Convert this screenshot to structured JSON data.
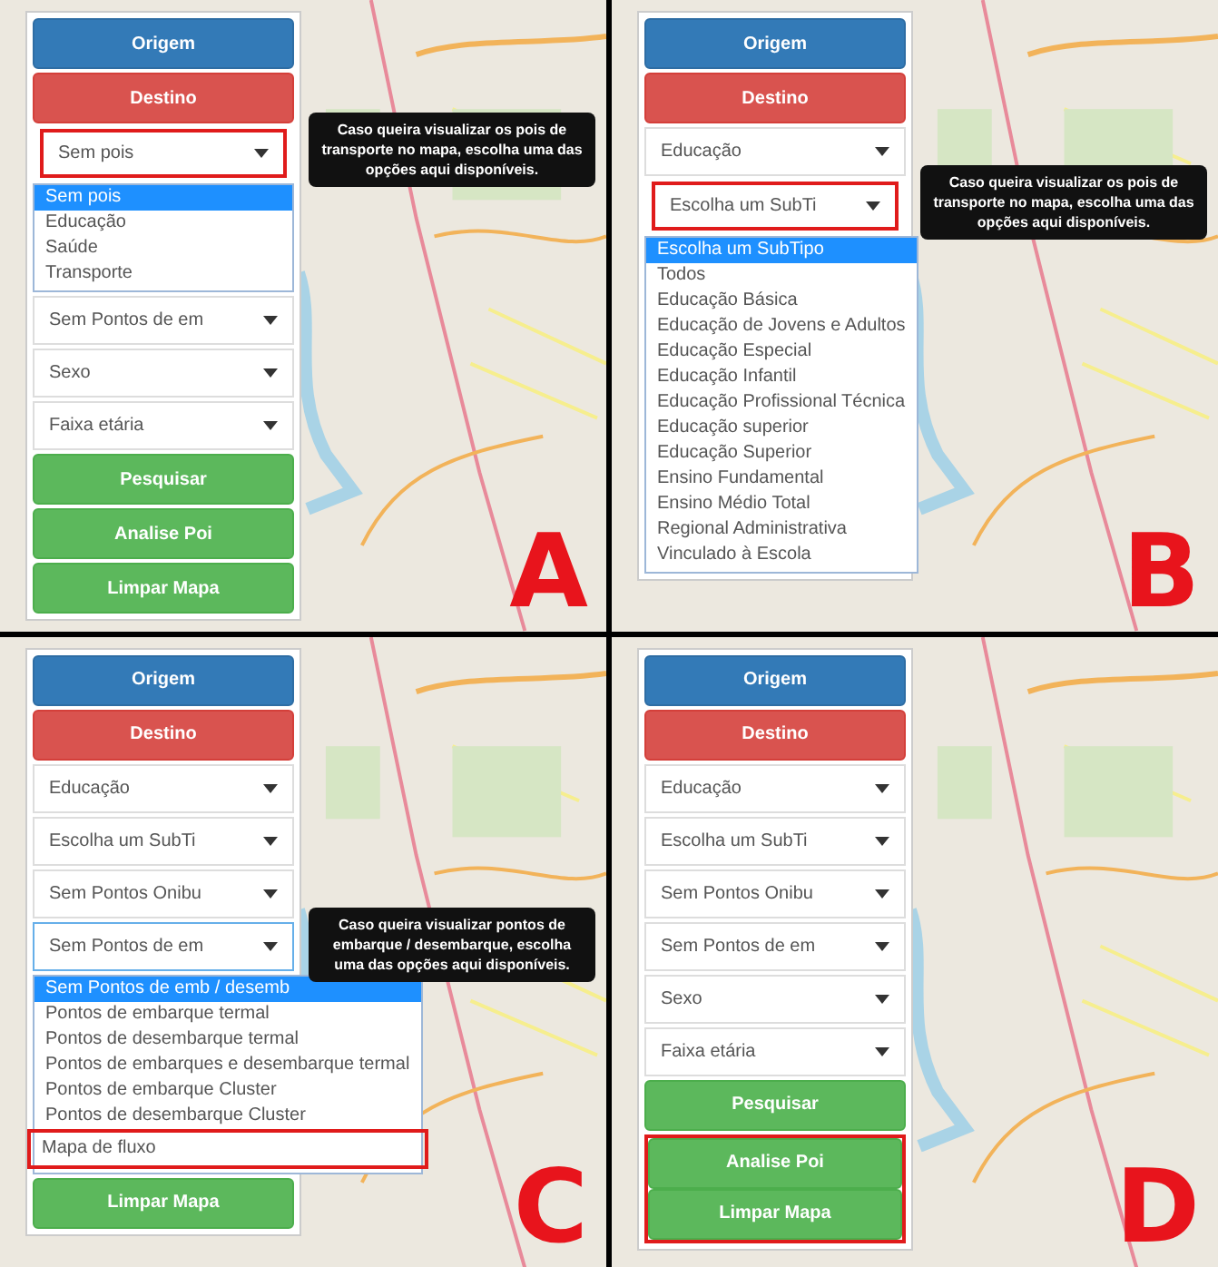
{
  "panels": [
    {
      "letter": "A",
      "controls": [
        {
          "kind": "primary",
          "label": "Origem",
          "highlighted": false
        },
        {
          "kind": "danger",
          "label": "Destino",
          "highlighted": false
        },
        {
          "kind": "select",
          "value": "Sem pois",
          "highlighted": true,
          "open": true,
          "tooltip": "Caso queira visualizar os pois de transporte no mapa, escolha uma das opções aqui disponíveis.",
          "options": [
            {
              "label": "Sem pois",
              "selected": true,
              "highlighted": false
            },
            {
              "label": "Educação",
              "selected": false,
              "highlighted": false
            },
            {
              "label": "Saúde",
              "selected": false,
              "highlighted": false
            },
            {
              "label": "Transporte",
              "selected": false,
              "highlighted": false
            }
          ]
        },
        {
          "kind": "select",
          "value": "Sem Pontos de em",
          "highlighted": false,
          "open": false
        },
        {
          "kind": "select",
          "value": "Sexo",
          "highlighted": false,
          "open": false
        },
        {
          "kind": "select",
          "value": "Faixa etária",
          "highlighted": false,
          "open": false
        },
        {
          "kind": "success",
          "label": "Pesquisar",
          "highlighted": false
        },
        {
          "kind": "success",
          "label": "Analise Poi",
          "highlighted": false
        },
        {
          "kind": "success",
          "label": "Limpar Mapa",
          "highlighted": false
        }
      ]
    },
    {
      "letter": "B",
      "controls": [
        {
          "kind": "primary",
          "label": "Origem",
          "highlighted": false
        },
        {
          "kind": "danger",
          "label": "Destino",
          "highlighted": false
        },
        {
          "kind": "select",
          "value": "Educação",
          "highlighted": false,
          "open": false
        },
        {
          "kind": "select",
          "value": "Escolha um SubTi",
          "highlighted": true,
          "open": true,
          "tooltip": "Caso queira visualizar os pois de transporte no mapa, escolha uma das opções aqui disponíveis.",
          "options": [
            {
              "label": "Escolha um SubTipo",
              "selected": true,
              "highlighted": false
            },
            {
              "label": "Todos",
              "selected": false,
              "highlighted": false
            },
            {
              "label": "Educação Básica",
              "selected": false,
              "highlighted": false
            },
            {
              "label": "Educação de Jovens e Adultos",
              "selected": false,
              "highlighted": false
            },
            {
              "label": "Educação Especial",
              "selected": false,
              "highlighted": false
            },
            {
              "label": "Educação Infantil",
              "selected": false,
              "highlighted": false
            },
            {
              "label": "Educação Profissional Técnica",
              "selected": false,
              "highlighted": false
            },
            {
              "label": "Educação superior",
              "selected": false,
              "highlighted": false
            },
            {
              "label": "Educação Superior",
              "selected": false,
              "highlighted": false
            },
            {
              "label": "Ensino Fundamental",
              "selected": false,
              "highlighted": false
            },
            {
              "label": "Ensino Médio Total",
              "selected": false,
              "highlighted": false
            },
            {
              "label": "Regional Administrativa",
              "selected": false,
              "highlighted": false
            },
            {
              "label": "Vinculado à Escola",
              "selected": false,
              "highlighted": false
            }
          ]
        }
      ]
    },
    {
      "letter": "C",
      "controls": [
        {
          "kind": "primary",
          "label": "Origem",
          "highlighted": false
        },
        {
          "kind": "danger",
          "label": "Destino",
          "highlighted": false
        },
        {
          "kind": "select",
          "value": "Educação",
          "highlighted": false,
          "open": false
        },
        {
          "kind": "select",
          "value": "Escolha um SubTi",
          "highlighted": false,
          "open": false
        },
        {
          "kind": "select",
          "value": "Sem Pontos Onibu",
          "highlighted": false,
          "open": false
        },
        {
          "kind": "select",
          "value": "Sem Pontos de em",
          "highlighted": false,
          "open": true,
          "tooltip": "Caso queira visualizar pontos de embarque / desembarque, escolha uma das opções aqui disponíveis.",
          "options": [
            {
              "label": "Sem Pontos de emb / desemb",
              "selected": true,
              "highlighted": false
            },
            {
              "label": "Pontos de embarque termal",
              "selected": false,
              "highlighted": false
            },
            {
              "label": "Pontos de desembarque termal",
              "selected": false,
              "highlighted": false
            },
            {
              "label": "Pontos de embarques e desembarque termal",
              "selected": false,
              "highlighted": false
            },
            {
              "label": "Pontos de embarque Cluster",
              "selected": false,
              "highlighted": false
            },
            {
              "label": "Pontos de desembarque Cluster",
              "selected": false,
              "highlighted": false
            },
            {
              "label": "Mapa de fluxo",
              "selected": false,
              "highlighted": true
            }
          ]
        },
        {
          "kind": "success",
          "label": "Limpar Mapa",
          "highlighted": false
        }
      ]
    },
    {
      "letter": "D",
      "controls": [
        {
          "kind": "primary",
          "label": "Origem",
          "highlighted": false
        },
        {
          "kind": "danger",
          "label": "Destino",
          "highlighted": false
        },
        {
          "kind": "select",
          "value": "Educação",
          "highlighted": false,
          "open": false
        },
        {
          "kind": "select",
          "value": "Escolha um SubTi",
          "highlighted": false,
          "open": false
        },
        {
          "kind": "select",
          "value": "Sem Pontos Onibu",
          "highlighted": false,
          "open": false
        },
        {
          "kind": "select",
          "value": "Sem Pontos de em",
          "highlighted": false,
          "open": false
        },
        {
          "kind": "select",
          "value": "Sexo",
          "highlighted": false,
          "open": false
        },
        {
          "kind": "select",
          "value": "Faixa etária",
          "highlighted": false,
          "open": false
        },
        {
          "kind": "success",
          "label": "Pesquisar",
          "highlighted": false
        },
        {
          "kind": "success",
          "label": "Analise Poi",
          "highlighted": true
        },
        {
          "kind": "success",
          "label": "Limpar Mapa",
          "highlighted": true
        }
      ]
    }
  ]
}
